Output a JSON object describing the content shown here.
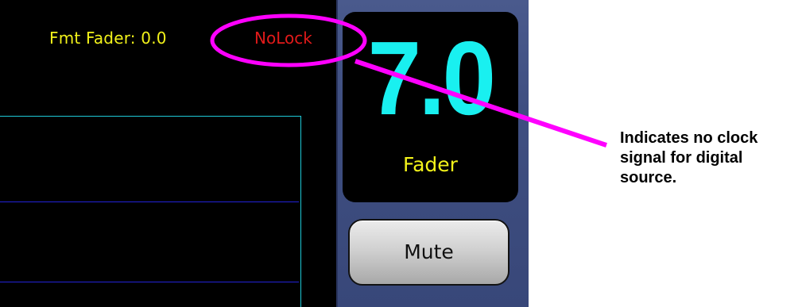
{
  "status": {
    "fmt_fader": "Fmt Fader: 0.0",
    "lock_status": "NoLock",
    "lock_color": "#e11a1a"
  },
  "fader": {
    "value": "7.0",
    "label": "Fader",
    "value_color": "#19f0f0",
    "label_color": "#f2f21a"
  },
  "mute": {
    "label": "Mute"
  },
  "callout": {
    "text": "Indicates no clock signal for digital source.",
    "highlight_color": "#ff00ff"
  }
}
